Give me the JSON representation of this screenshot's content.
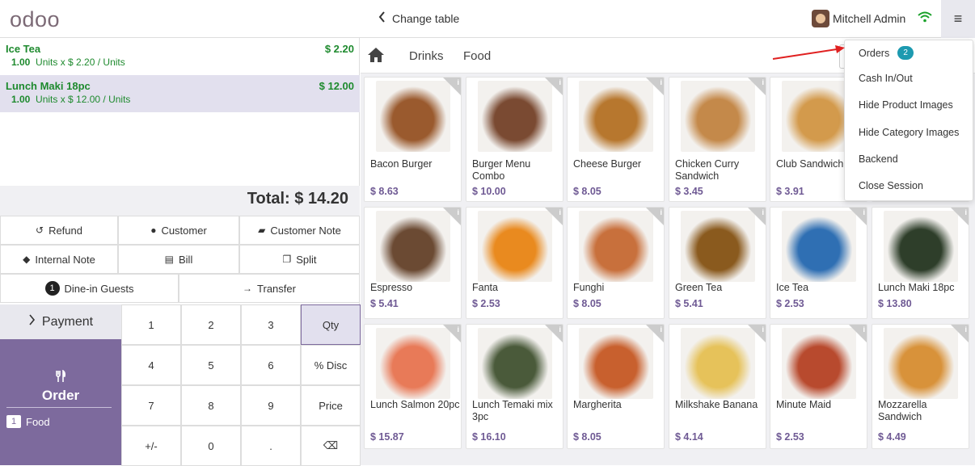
{
  "header": {
    "logo": "odoo",
    "change_table": "Change table",
    "user_name": "Mitchell Admin"
  },
  "order_lines": [
    {
      "name": "Ice Tea",
      "price": "$ 2.20",
      "qty": "1.00",
      "detail": "Units x $ 2.20 / Units",
      "selected": false
    },
    {
      "name": "Lunch Maki 18pc",
      "price": "$ 12.00",
      "qty": "1.00",
      "detail": "Units x $ 12.00 / Units",
      "selected": true
    }
  ],
  "total": "Total: $ 14.20",
  "controls": {
    "refund": "Refund",
    "customer": "Customer",
    "customer_note": "Customer Note",
    "internal_note": "Internal Note",
    "bill": "Bill",
    "split": "Split",
    "guests_count": "1",
    "dine_in_guests": "Dine-in Guests",
    "transfer": "Transfer"
  },
  "payment": "Payment",
  "order_panel": {
    "label": "Order",
    "sub_count": "1",
    "sub_label": "Food"
  },
  "numpad": [
    [
      "1",
      "2",
      "3",
      "Qty"
    ],
    [
      "4",
      "5",
      "6",
      "% Disc"
    ],
    [
      "7",
      "8",
      "9",
      "Price"
    ],
    [
      "+/-",
      "0",
      ".",
      "⌫"
    ]
  ],
  "categories": [
    "Drinks",
    "Food"
  ],
  "products": [
    {
      "name": "Bacon Burger",
      "price": "$ 8.63",
      "color": "#9a5a2e"
    },
    {
      "name": "Burger Menu Combo",
      "price": "$ 10.00",
      "color": "#7a4a32"
    },
    {
      "name": "Cheese Burger",
      "price": "$ 8.05",
      "color": "#b7772e"
    },
    {
      "name": "Chicken Curry Sandwich",
      "price": "$ 3.45",
      "color": "#c4894a"
    },
    {
      "name": "Club Sandwich",
      "price": "$ 3.91",
      "color": "#d39a4c"
    },
    {
      "name": "",
      "price": "",
      "color": "#ffffff"
    },
    {
      "name": "Espresso",
      "price": "$ 5.41",
      "color": "#6b4a33"
    },
    {
      "name": "Fanta",
      "price": "$ 2.53",
      "color": "#e98a1f"
    },
    {
      "name": "Funghi",
      "price": "$ 8.05",
      "color": "#c8703c"
    },
    {
      "name": "Green Tea",
      "price": "$ 5.41",
      "color": "#8a5a1e"
    },
    {
      "name": "Ice Tea",
      "price": "$ 2.53",
      "color": "#2f6fb3"
    },
    {
      "name": "Lunch Maki 18pc",
      "price": "$ 13.80",
      "color": "#2e3e2a"
    },
    {
      "name": "Lunch Salmon 20pc",
      "price": "$ 15.87",
      "color": "#e87a58"
    },
    {
      "name": "Lunch Temaki mix 3pc",
      "price": "$ 16.10",
      "color": "#4a5a3a"
    },
    {
      "name": "Margherita",
      "price": "$ 8.05",
      "color": "#c8602e"
    },
    {
      "name": "Milkshake Banana",
      "price": "$ 4.14",
      "color": "#e6c25a"
    },
    {
      "name": "Minute Maid",
      "price": "$ 2.53",
      "color": "#b84a2e"
    },
    {
      "name": "Mozzarella Sandwich",
      "price": "$ 4.49",
      "color": "#d8923a"
    }
  ],
  "menu": {
    "orders": "Orders",
    "orders_count": "2",
    "cash": "Cash In/Out",
    "hide_product_images": "Hide Product Images",
    "hide_category_images": "Hide Category Images",
    "backend": "Backend",
    "close_session": "Close Session"
  }
}
